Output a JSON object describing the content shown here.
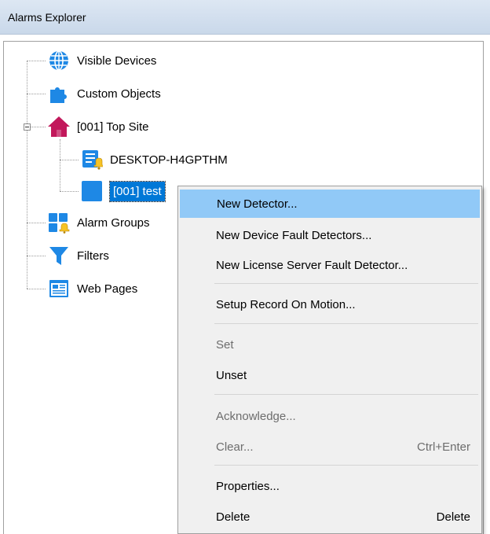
{
  "window": {
    "title": "Alarms Explorer"
  },
  "tree": {
    "items": [
      {
        "label": "Visible Devices",
        "icon": "globe-icon"
      },
      {
        "label": "Custom Objects",
        "icon": "puzzle-icon"
      },
      {
        "label": "[001] Top Site",
        "icon": "house-icon",
        "expanded": true,
        "children": [
          {
            "label": "DESKTOP-H4GPTHM",
            "icon": "server-alarm-icon"
          },
          {
            "label": "[001] test",
            "icon": "camera-box-icon",
            "selected": true
          }
        ]
      },
      {
        "label": "Alarm Groups",
        "icon": "alarm-groups-icon"
      },
      {
        "label": "Filters",
        "icon": "funnel-icon"
      },
      {
        "label": "Web Pages",
        "icon": "web-page-icon"
      }
    ]
  },
  "context_menu": {
    "items": [
      {
        "label": "New Detector...",
        "shortcut": "",
        "enabled": true,
        "highlighted": true
      },
      {
        "label": "New Device Fault Detectors...",
        "shortcut": "",
        "enabled": true
      },
      {
        "label": "New License Server Fault Detector...",
        "shortcut": "",
        "enabled": true
      },
      {
        "label": "Setup Record On Motion...",
        "shortcut": "",
        "enabled": true
      },
      {
        "label": "Set",
        "shortcut": "",
        "enabled": false
      },
      {
        "label": "Unset",
        "shortcut": "",
        "enabled": true
      },
      {
        "label": "Acknowledge...",
        "shortcut": "",
        "enabled": false
      },
      {
        "label": "Clear...",
        "shortcut": "Ctrl+Enter",
        "enabled": false
      },
      {
        "label": "Properties...",
        "shortcut": "",
        "enabled": true
      },
      {
        "label": "Delete",
        "shortcut": "Delete",
        "enabled": true
      }
    ]
  },
  "colors": {
    "selection": "#0078d7",
    "menu_highlight": "#91c9f7",
    "icon_blue": "#1e88e5",
    "icon_red": "#c2185b"
  }
}
